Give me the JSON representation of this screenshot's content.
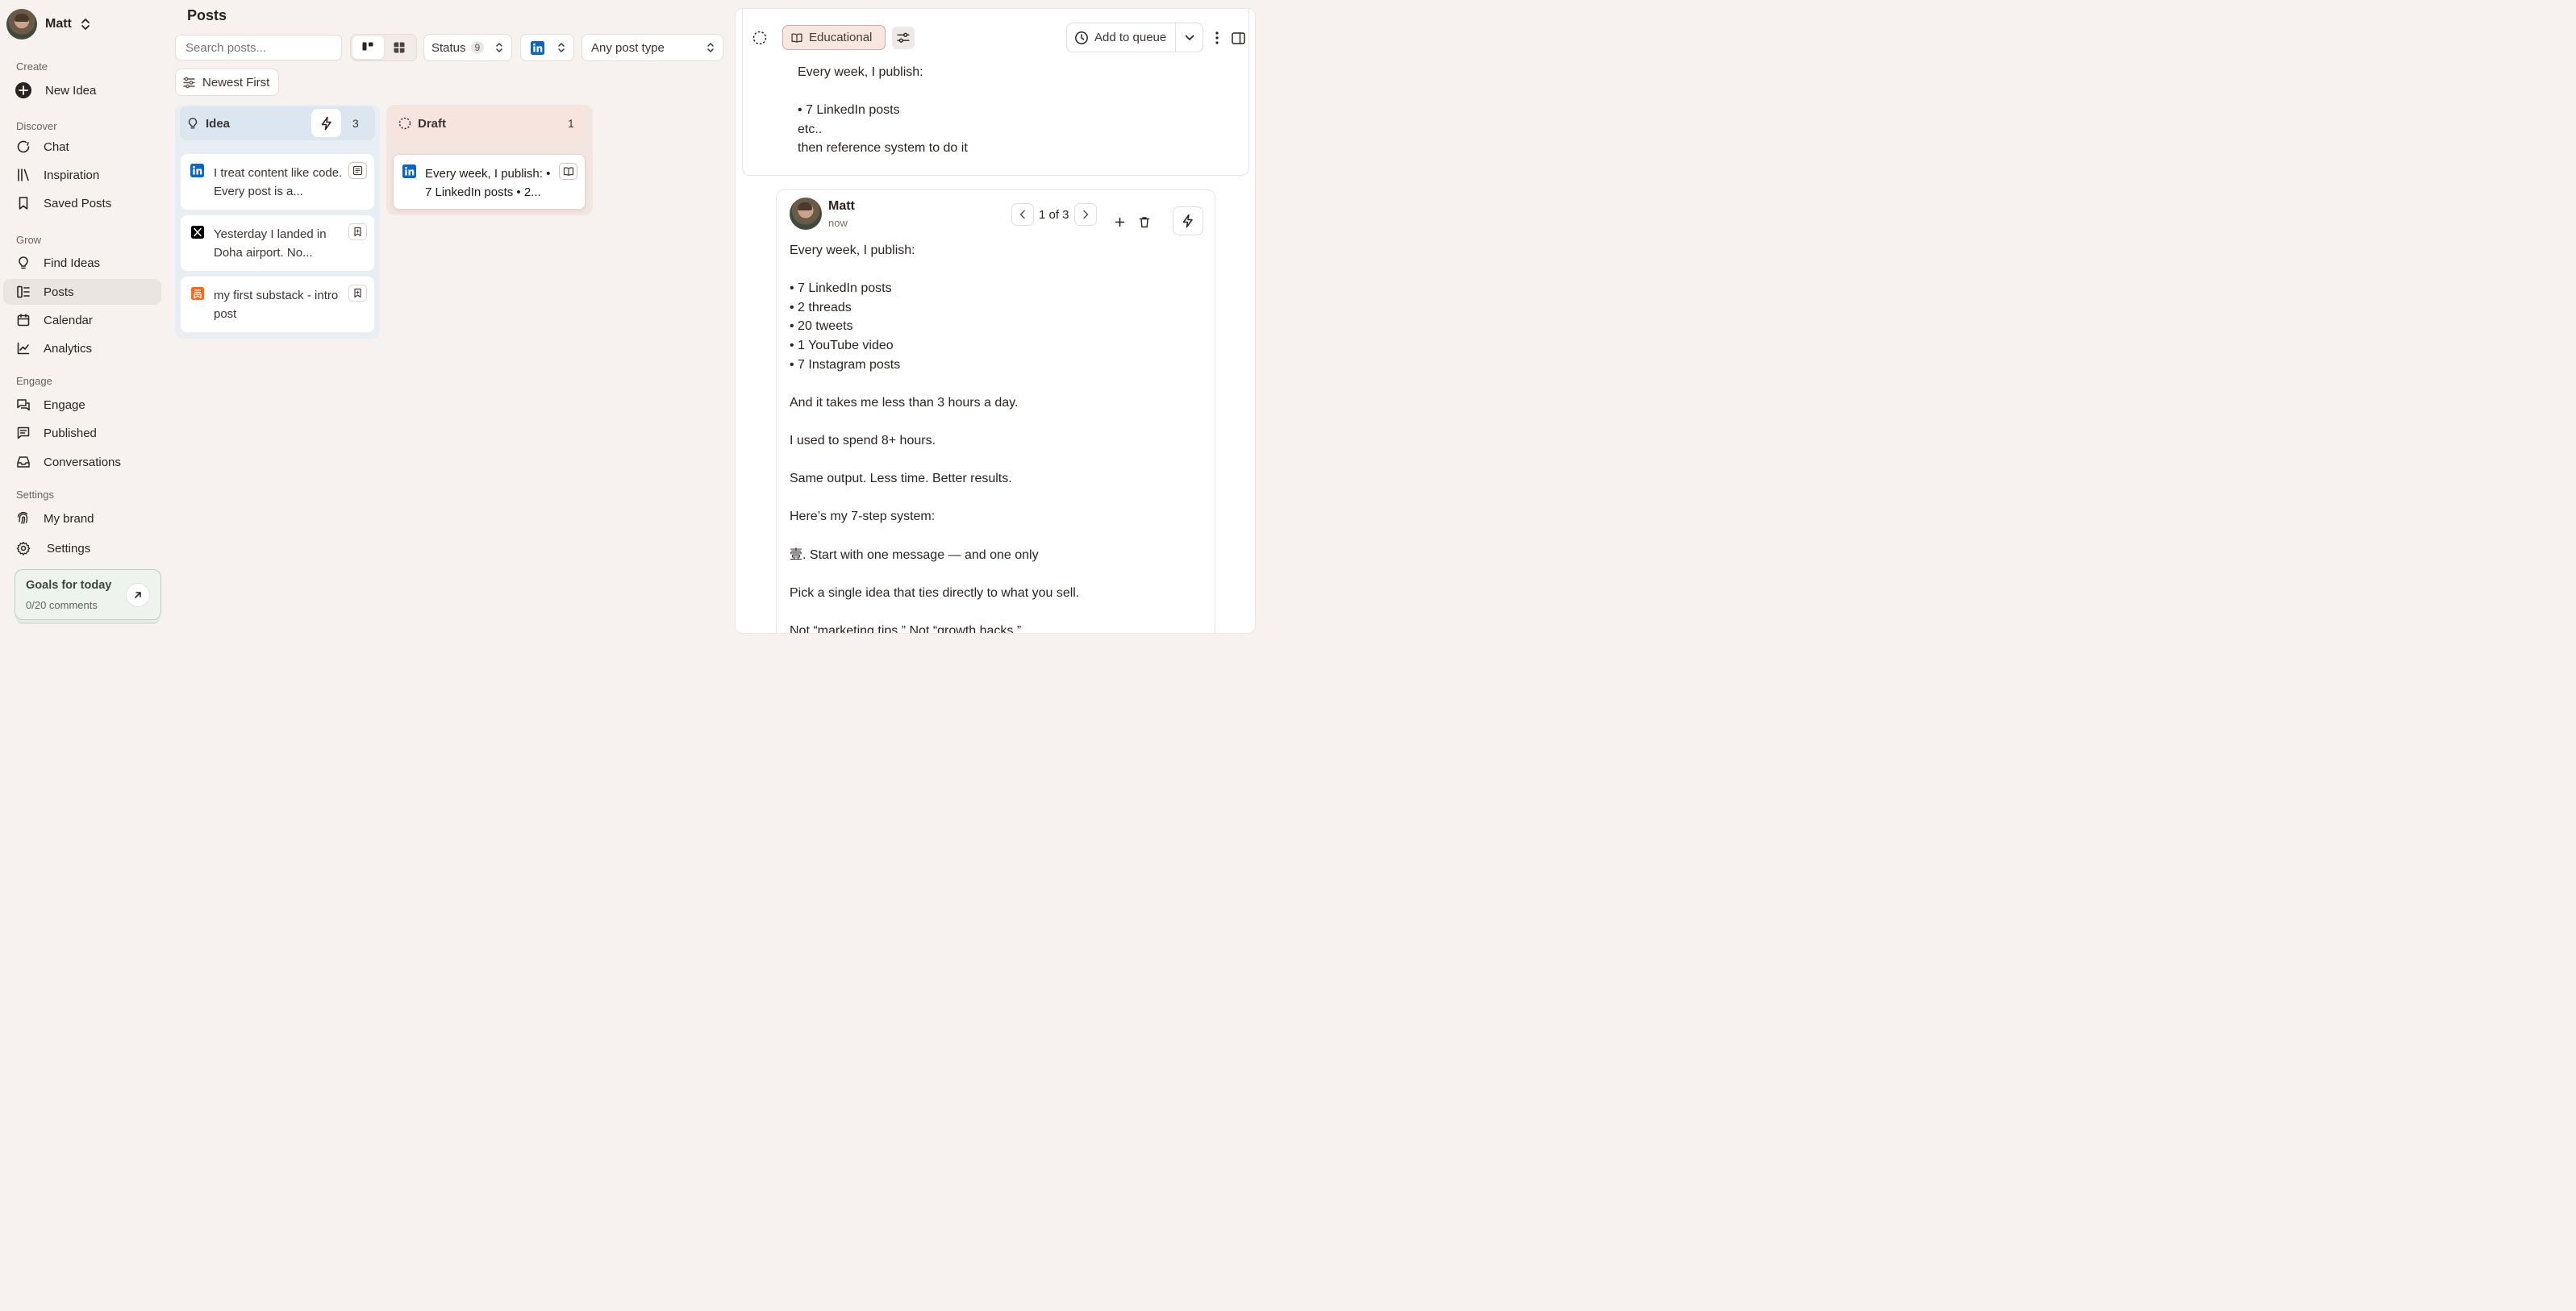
{
  "user": {
    "name": "Matt"
  },
  "sidebar": {
    "sections": {
      "create": "Create",
      "discover": "Discover",
      "grow": "Grow",
      "engage": "Engage",
      "settings": "Settings"
    },
    "items": {
      "new_idea": "New Idea",
      "chat": "Chat",
      "inspiration": "Inspiration",
      "saved_posts": "Saved Posts",
      "find_ideas": "Find Ideas",
      "posts": "Posts",
      "calendar": "Calendar",
      "analytics": "Analytics",
      "engage": "Engage",
      "published": "Published",
      "conversations": "Conversations",
      "my_brand": "My brand",
      "settings": "Settings"
    },
    "goals": {
      "title": "Goals for today",
      "progress_text": "0/20 comments"
    }
  },
  "main": {
    "title": "Posts",
    "search": {
      "placeholder": "Search posts..."
    },
    "filters": {
      "status_label": "Status",
      "status_count": "9",
      "platform_icon": "linkedin-icon",
      "post_type": "Any post type",
      "sort": "Newest First"
    },
    "columns": {
      "idea": {
        "label": "Idea",
        "count": "3",
        "cards": [
          {
            "platform": "linkedin",
            "text": "I treat content like code. Every post is a..."
          },
          {
            "platform": "x",
            "text": "Yesterday I landed in Doha airport. No..."
          },
          {
            "platform": "substack",
            "text": "my first substack - intro post"
          }
        ]
      },
      "draft": {
        "label": "Draft",
        "count": "1",
        "cards": [
          {
            "platform": "linkedin",
            "text": "Every week, I publish: • 7 LinkedIn posts • 2..."
          }
        ]
      }
    }
  },
  "panel": {
    "tag": "Educational",
    "queue_label": "Add to queue",
    "idea_text": "Every week, I publish:\n\n• 7 LinkedIn posts\netc..\nthen reference system to do it",
    "editor": {
      "author": "Matt",
      "time": "now",
      "pager": "1 of 3",
      "body": "Every week, I publish:\n\n• 7 LinkedIn posts\n• 2 threads\n• 20 tweets\n• 1 YouTube video\n• 7 Instagram posts\n\nAnd it takes me less than 3 hours a day.\n\nI used to spend 8+ hours.\n\nSame output. Less time. Better results.\n\nHere’s my 7-step system:\n\n壹. Start with one message — and one only\n\nPick a single idea that ties directly to what you sell.\n\nNot “marketing tips.” Not “growth hacks.”"
    }
  },
  "colors": {
    "linkedin": "#0a66c2",
    "x": "#000000",
    "substack": "#ff6719",
    "accent_tag": "#f8e6e0",
    "goals_border": "#b7d0c0"
  }
}
